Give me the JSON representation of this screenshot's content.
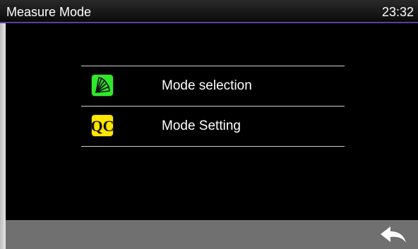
{
  "header": {
    "title": "Measure Mode",
    "clock": "23:32"
  },
  "menu": {
    "items": [
      {
        "label": "Mode selection",
        "icon": "fan-icon",
        "icon_color": "#2fe82a"
      },
      {
        "label": "Mode Setting",
        "icon": "qc-icon",
        "icon_color": "#ffe500",
        "icon_text": "QC"
      }
    ]
  },
  "footer": {
    "back_icon": "back-arrow-icon"
  },
  "colors": {
    "accent_line": "#5a3fa0",
    "footer_bg": "#707070"
  }
}
